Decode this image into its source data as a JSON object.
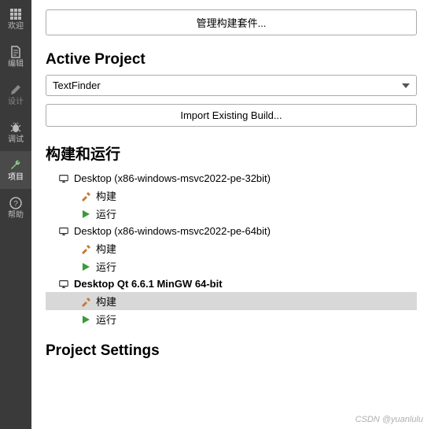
{
  "sidebar": {
    "items": [
      {
        "label": "欢迎"
      },
      {
        "label": "编辑"
      },
      {
        "label": "设计"
      },
      {
        "label": "调试"
      },
      {
        "label": "项目"
      },
      {
        "label": "帮助"
      }
    ]
  },
  "buttons": {
    "manage_kits": "管理构建套件...",
    "import_build": "Import Existing Build..."
  },
  "sections": {
    "active_project": "Active Project",
    "build_run": "构建和运行",
    "project_settings": "Project Settings"
  },
  "project_select": {
    "value": "TextFinder"
  },
  "kits": [
    {
      "name": "Desktop (x86-windows-msvc2022-pe-32bit)",
      "selected": false,
      "actions": [
        {
          "type": "build",
          "label": "构建",
          "selected": false
        },
        {
          "type": "run",
          "label": "运行",
          "selected": false
        }
      ]
    },
    {
      "name": "Desktop (x86-windows-msvc2022-pe-64bit)",
      "selected": false,
      "actions": [
        {
          "type": "build",
          "label": "构建",
          "selected": false
        },
        {
          "type": "run",
          "label": "运行",
          "selected": false
        }
      ]
    },
    {
      "name": "Desktop Qt 6.6.1 MinGW 64-bit",
      "selected": true,
      "actions": [
        {
          "type": "build",
          "label": "构建",
          "selected": true
        },
        {
          "type": "run",
          "label": "运行",
          "selected": false
        }
      ]
    }
  ],
  "watermark": "CSDN @yuanlulu"
}
